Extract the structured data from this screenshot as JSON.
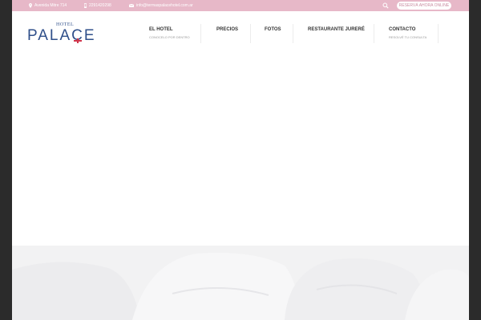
{
  "topbar": {
    "address": "Avenida Mitre 714",
    "phone": "2291420298",
    "email": "info@termaspalacehotel.com.ar",
    "reserve_label": "RESERVÁ AHORA ONLINE"
  },
  "logo": {
    "small": "HOTEL",
    "main": "PALACE"
  },
  "nav": [
    {
      "label": "EL HOTEL",
      "sub": "CONOCELO POR DENTRO"
    },
    {
      "label": "PRECIOS",
      "sub": ""
    },
    {
      "label": "FOTOS",
      "sub": ""
    },
    {
      "label": "RESTAURANTE JURERÉ",
      "sub": ""
    },
    {
      "label": "CONTACTO",
      "sub": "RESOLVÉ TU CONSULTA"
    }
  ],
  "colors": {
    "topbar": "#e7b8c8",
    "brand_blue": "#2f4f8a",
    "brand_red": "#d0344a",
    "side_background": "#2b2b2b"
  }
}
